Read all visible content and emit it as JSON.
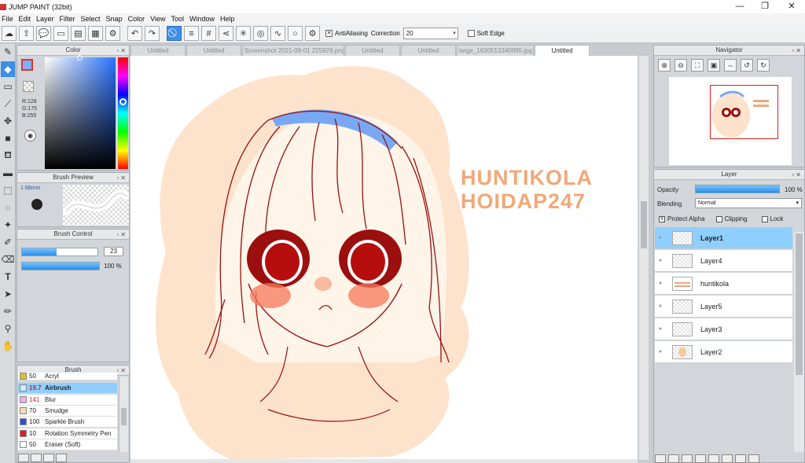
{
  "window": {
    "title": "JUMP PAINT (32bit)",
    "controls": [
      "—",
      "❐",
      "✕"
    ]
  },
  "menu": [
    "File",
    "Edit",
    "Layer",
    "Filter",
    "Select",
    "Snap",
    "Color",
    "View",
    "Tool",
    "Window",
    "Help"
  ],
  "toolbar": {
    "antialiasing_label": "AntiAliasing",
    "correction_label": "Correction",
    "correction_value": "20",
    "soft_edge_label": "Soft Edge"
  },
  "color_panel": {
    "title": "Color",
    "r": "R:128",
    "g": "G:175",
    "b": "B:255",
    "fg_color": "#80afff"
  },
  "brush_preview": {
    "title": "Brush Preview",
    "size": "1.68mm"
  },
  "brush_control": {
    "title": "Brush Control",
    "size_value": "23",
    "size_fraction": 0.46,
    "opacity_value": "100 %",
    "opacity_fraction": 1.0
  },
  "brush_list": {
    "title": "Brush",
    "items": [
      {
        "num": "50",
        "name": "Acryl",
        "color": "#d4c233"
      },
      {
        "num": "19.7",
        "name": "Airbrush",
        "color": "#8fcfff",
        "selected": true
      },
      {
        "num": "141",
        "name": "Blur",
        "color": "#f0b0e8"
      },
      {
        "num": "70",
        "name": "Smudge",
        "color": "#f5dcb4"
      },
      {
        "num": "100",
        "name": "Sparkle Brush",
        "color": "#3050e0"
      },
      {
        "num": "10",
        "name": "Rotation Symmetry Pen",
        "color": "#e02020"
      },
      {
        "num": "50",
        "name": "Eraser (Soft)",
        "color": "#ffffff"
      }
    ]
  },
  "tabs": [
    {
      "label": "Untitled"
    },
    {
      "label": "Untitled"
    },
    {
      "label": "Screenshot 2021-09-01 225929.png"
    },
    {
      "label": "Untitled"
    },
    {
      "label": "Untitled"
    },
    {
      "label": "large_1630513340895.jpg"
    },
    {
      "label": "Untitled",
      "active": true
    }
  ],
  "canvas": {
    "watermark_line1": "HUNTIKOLA",
    "watermark_line2": "HOIDAP247",
    "accent": "#f0a878",
    "bg_blob": "#fde3cc",
    "line_color": "#9a1010"
  },
  "navigator": {
    "title": "Navigator"
  },
  "layers": {
    "title": "Layer",
    "opacity_label": "Opacity",
    "opacity_value": "100 %",
    "blending_label": "Blending",
    "blending_value": "Normal",
    "protect_alpha_label": "Protect Alpha",
    "clipping_label": "Clipping",
    "lock_label": "Lock",
    "items": [
      {
        "name": "Layer1",
        "selected": true
      },
      {
        "name": "Layer4"
      },
      {
        "name": "huntikola"
      },
      {
        "name": "Layer5"
      },
      {
        "name": "Layer3"
      },
      {
        "name": "Layer2"
      }
    ]
  }
}
